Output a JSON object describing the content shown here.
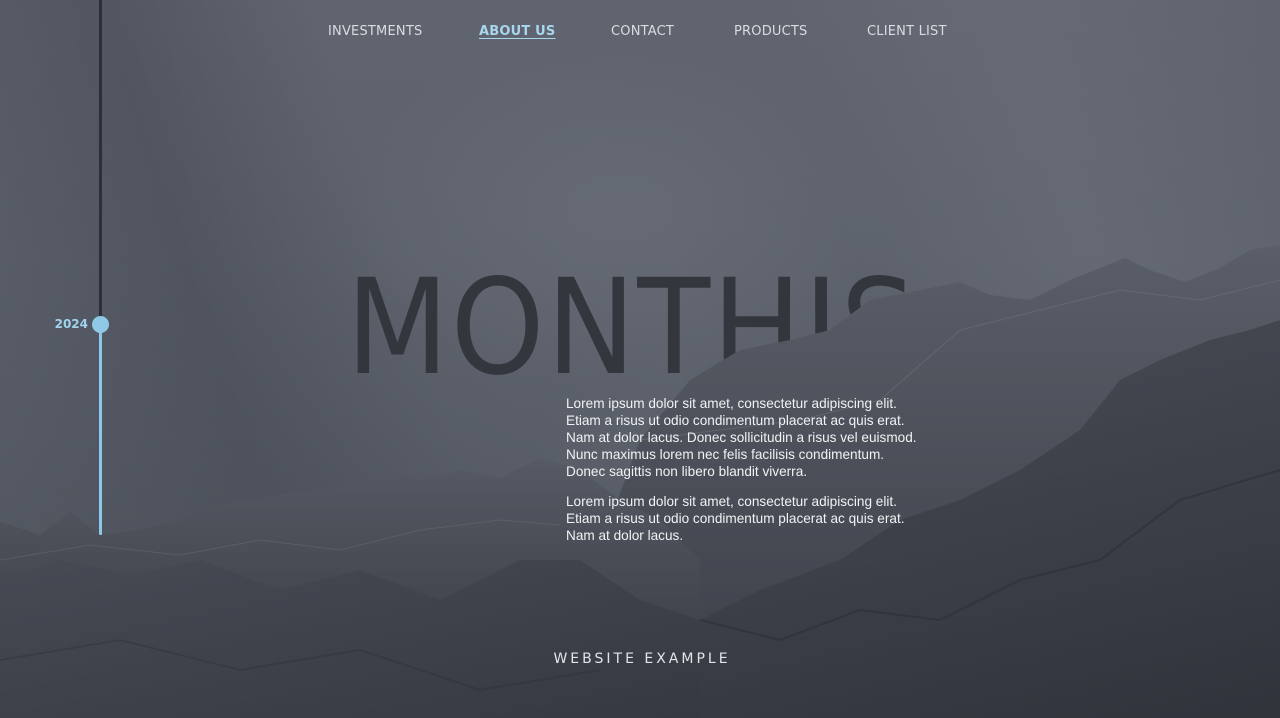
{
  "nav": {
    "items": [
      {
        "label": "INVESTMENTS",
        "active": false
      },
      {
        "label": "ABOUT US",
        "active": true
      },
      {
        "label": "CONTACT",
        "active": false
      },
      {
        "label": "PRODUCTS",
        "active": false
      },
      {
        "label": "CLIENT LIST",
        "active": false
      }
    ]
  },
  "timeline": {
    "year": "2024"
  },
  "hero": {
    "title": "MONTHIS"
  },
  "content": {
    "paragraphs": [
      {
        "lines": [
          "Lorem ipsum dolor sit amet, consectetur adipiscing elit.",
          "Etiam a risus ut odio condimentum placerat ac quis erat.",
          "Nam at dolor lacus. Donec sollicitudin a risus vel euismod.",
          "Nunc maximus lorem nec felis facilisis condimentum.",
          "Donec sagittis non libero blandit viverra."
        ]
      },
      {
        "lines": [
          "Lorem ipsum dolor sit amet, consectetur adipiscing elit.",
          "Etiam a risus ut odio condimentum placerat ac quis erat.",
          "Nam at dolor lacus."
        ]
      }
    ]
  },
  "footer": {
    "label": "WEBSITE EXAMPLE"
  },
  "colors": {
    "accent": "#8fc8e6",
    "nav_active": "#a8d6ee",
    "title": "#33363d",
    "background": "#5d626c",
    "mountain": "#3e424b"
  }
}
